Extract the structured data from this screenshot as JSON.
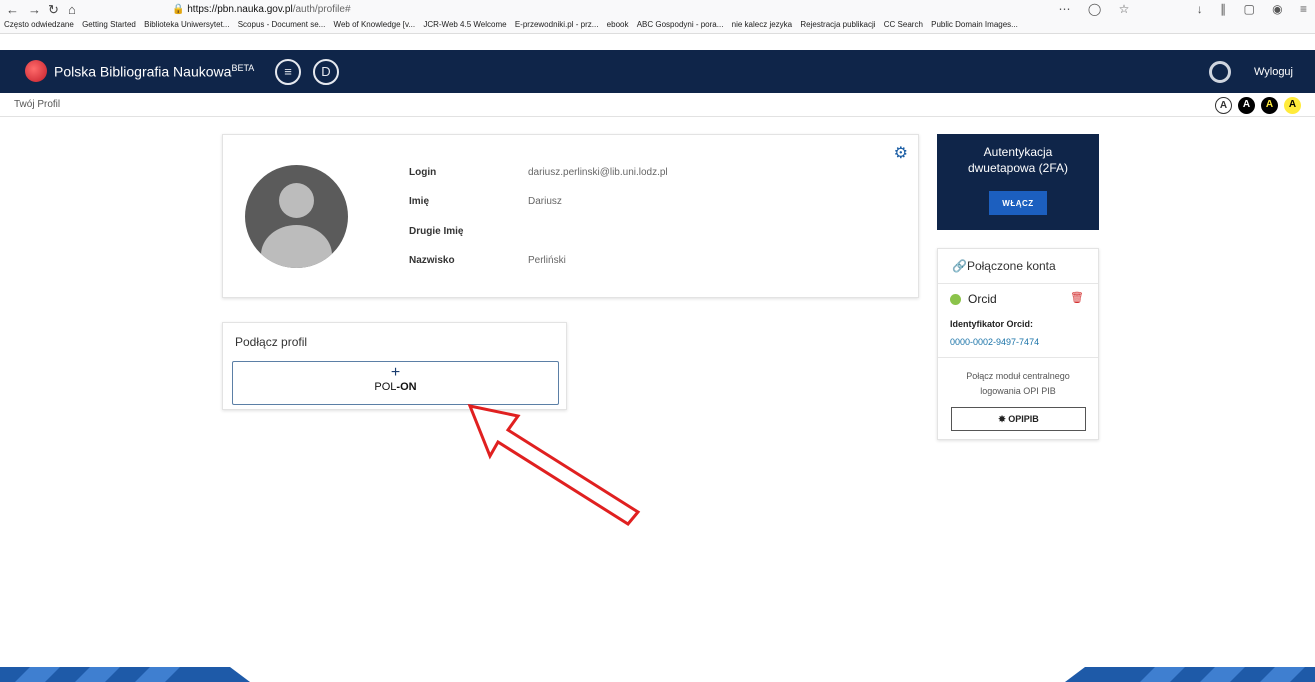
{
  "browser": {
    "url_host": "https://pbn.nauka.gov.pl",
    "url_path": "/auth/profile#",
    "bookmarks": [
      "Często odwiedzane",
      "Getting Started",
      "Biblioteka Uniwersytet...",
      "Scopus - Document se...",
      "Web of Knowledge [v...",
      "JCR-Web 4.5 Welcome",
      "E-przewodniki.pl - prz...",
      "ebook",
      "ABC Gospodyni - pora...",
      "nie kalecz jezyka",
      "Rejestracja publikacji",
      "CC Search",
      "Public Domain Images..."
    ]
  },
  "header": {
    "title": "Polska Bibliografia Naukowa",
    "beta": "BETA",
    "logout": "Wyloguj",
    "colors": {
      "navy": "#0f2549",
      "accent": "#1c5fbf"
    }
  },
  "breadcrumb": "Twój Profil",
  "contrast_letter": "A",
  "profile": {
    "fields": [
      {
        "label": "Login",
        "value": "dariusz.perlinski@lib.uni.lodz.pl"
      },
      {
        "label": "Imię",
        "value": "Dariusz"
      },
      {
        "label": "Drugie Imię",
        "value": ""
      },
      {
        "label": "Nazwisko",
        "value": "Perliński"
      }
    ]
  },
  "connect": {
    "title": "Podłącz profil",
    "button_plus": "+",
    "button_label_a": "POL",
    "button_label_b": "-ON"
  },
  "tfa": {
    "title_line1": "Autentykacja",
    "title_line2": "dwuetapowa (2FA)",
    "button": "WŁĄCZ"
  },
  "linked": {
    "title": "Połączone konta",
    "service": "Orcid",
    "id_label": "Identyfikator Orcid:",
    "id_value": "0000-0002-9497-7474",
    "opi_text_line1": "Połącz moduł centralnego",
    "opi_text_line2": "logowania OPI PIB",
    "opi_button": "OPIPIB"
  },
  "icons": {
    "gear": "gear-icon",
    "trash": "trash-icon",
    "link": "link-icon",
    "help": "lifebuoy-icon"
  }
}
